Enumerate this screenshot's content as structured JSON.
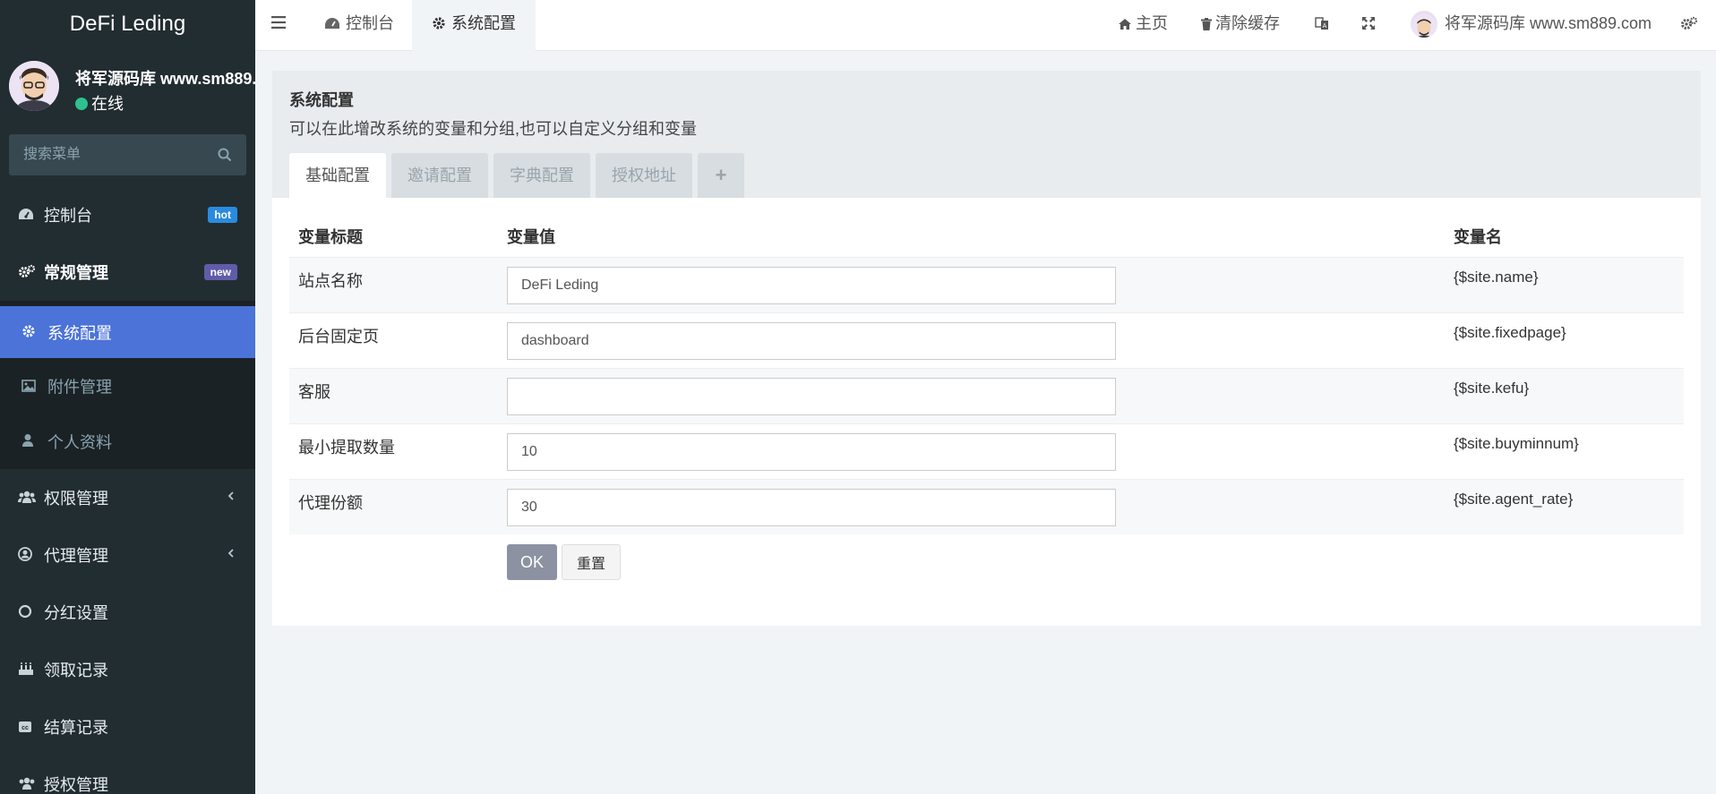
{
  "app": {
    "logo": "DeFi Leding"
  },
  "user": {
    "name": "将军源码库 www.sm889.com",
    "status": "在线"
  },
  "sidebar": {
    "search_placeholder": "搜索菜单",
    "items": [
      {
        "label": "控制台",
        "icon": "dashboard-icon",
        "badge": "hot"
      },
      {
        "label": "常规管理",
        "icon": "cogs-icon",
        "badge": "new"
      },
      {
        "label": "系统配置",
        "icon": "gear-icon"
      },
      {
        "label": "附件管理",
        "icon": "image-icon"
      },
      {
        "label": "个人资料",
        "icon": "user-icon"
      },
      {
        "label": "权限管理",
        "icon": "users-icon"
      },
      {
        "label": "代理管理",
        "icon": "user-circle-icon"
      },
      {
        "label": "分红设置",
        "icon": "circle-icon"
      },
      {
        "label": "领取记录",
        "icon": "cake-icon"
      },
      {
        "label": "结算记录",
        "icon": "cc-icon"
      },
      {
        "label": "授权管理",
        "icon": "users-icon"
      }
    ]
  },
  "topbar": {
    "tabs": [
      {
        "label": "控制台"
      },
      {
        "label": "系统配置"
      }
    ],
    "home": "主页",
    "clear_cache": "清除缓存",
    "user_name": "将军源码库 www.sm889.com"
  },
  "page": {
    "title": "系统配置",
    "description": "可以在此增改系统的变量和分组,也可以自定义分组和变量",
    "tabs": [
      "基础配置",
      "邀请配置",
      "字典配置",
      "授权地址"
    ],
    "add_tab": "+"
  },
  "config_table": {
    "headers": [
      "变量标题",
      "变量值",
      "变量名"
    ],
    "rows": [
      {
        "title": "站点名称",
        "value": "DeFi Leding",
        "name": "{$site.name}"
      },
      {
        "title": "后台固定页",
        "value": "dashboard",
        "name": "{$site.fixedpage}"
      },
      {
        "title": "客服",
        "value": "",
        "name": "{$site.kefu}"
      },
      {
        "title": "最小提取数量",
        "value": "10",
        "name": "{$site.buyminnum}"
      },
      {
        "title": "代理份额",
        "value": "30",
        "name": "{$site.agent_rate}"
      }
    ]
  },
  "buttons": {
    "ok": "OK",
    "reset": "重置"
  },
  "colors": {
    "sidebar_bg": "#222d32",
    "active_menu": "#4b73d8",
    "badge_hot": "#2a8bde",
    "badge_new": "#605ca8",
    "online": "#2ec08f",
    "ok_button": "#8c92a2"
  }
}
